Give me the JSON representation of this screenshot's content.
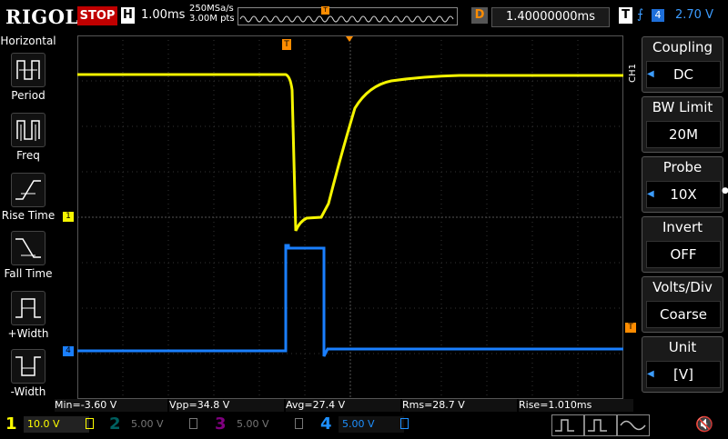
{
  "brand": "RIGOL",
  "run_state": "STOP",
  "horizontal_letter": "H",
  "timebase": "1.00ms",
  "sample_rate": "250MSa/s",
  "memory_depth": "3.00M pts",
  "delay_letter": "D",
  "delay_value": "1.40000000ms",
  "trigger": {
    "letter": "T",
    "source": "4",
    "level": "2.70 V"
  },
  "left_menu": {
    "title": "Horizontal",
    "items": [
      "Period",
      "Freq",
      "Rise Time",
      "Fall Time",
      "+Width",
      "-Width"
    ]
  },
  "right_menu": {
    "channel_label": "CH1",
    "items": [
      {
        "title": "Coupling",
        "value": "DC"
      },
      {
        "title": "BW Limit",
        "value": "20M"
      },
      {
        "title": "Probe",
        "value": "10X"
      },
      {
        "title": "Invert",
        "value": "OFF"
      },
      {
        "title": "Volts/Div",
        "value": "Coarse"
      },
      {
        "title": "Unit",
        "value": "[V]"
      }
    ]
  },
  "measurements": [
    "Min=-3.60 V",
    "Vpp=34.8 V",
    "Avg=27.4 V",
    "Rms=28.7 V",
    "Rise=1.010ms"
  ],
  "markers": {
    "ch1": "1",
    "ch4": "4",
    "trigger_level": "T",
    "trigger_pos": "T"
  },
  "channels": [
    {
      "num": "1",
      "value": "10.0 V",
      "color": "#ffff00",
      "active": true
    },
    {
      "num": "2",
      "value": "5.00 V",
      "color": "#00c0c0",
      "active": false
    },
    {
      "num": "3",
      "value": "5.00 V",
      "color": "#ff00ff",
      "active": false
    },
    {
      "num": "4",
      "value": "5.00 V",
      "color": "#1e90ff",
      "active": true
    }
  ],
  "colors": {
    "ch1": "#f5f500",
    "ch4": "#1a7fff",
    "trigger": "#ff8c00",
    "grid": "#444444",
    "stop": "#c00000"
  },
  "icons": {
    "sound": "speaker-muted-icon"
  }
}
